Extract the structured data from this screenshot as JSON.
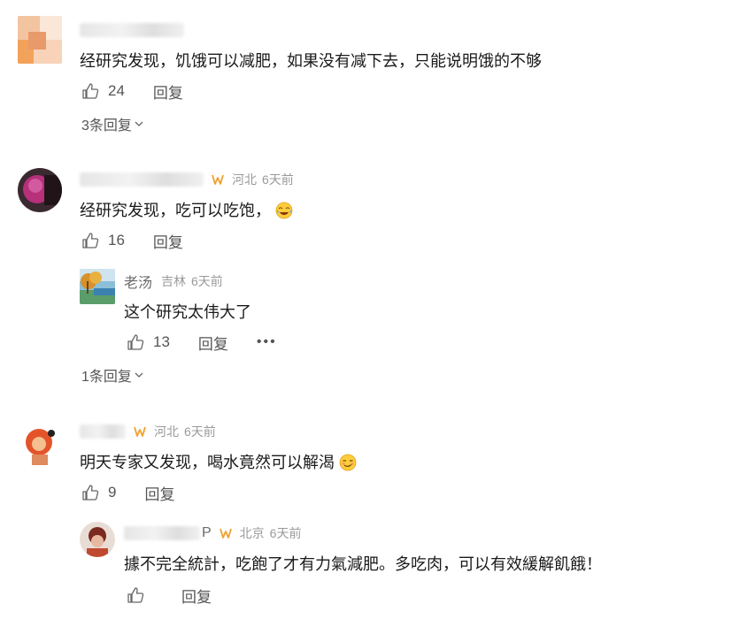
{
  "comments": [
    {
      "text": "经研究发现，饥饿可以减肥，如果没有减下去，只能说明饿的不够",
      "likes": "24",
      "reply_label": "回复",
      "expand_label": "3条回复"
    },
    {
      "location": "河北",
      "time": "6天前",
      "text": "经研究发现，吃可以吃饱，",
      "likes": "16",
      "reply_label": "回复",
      "reply": {
        "name": "老汤",
        "location": "吉林",
        "time": "6天前",
        "text": "这个研究太伟大了",
        "likes": "13",
        "reply_label": "回复",
        "more_label": "•••"
      },
      "expand_label": "1条回复"
    },
    {
      "location": "河北",
      "time": "6天前",
      "text": "明天专家又发现，喝水竟然可以解渴",
      "likes": "9",
      "reply_label": "回复",
      "reply": {
        "name_tail": "P",
        "location": "北京",
        "time": "6天前",
        "text": "據不完全統計，吃飽了才有力氣減肥。多吃肉，可以有效緩解飢餓！",
        "reply_label": "回复"
      }
    }
  ],
  "colors": {
    "vip": "#f0a030",
    "muted": "#9a9a9a"
  }
}
